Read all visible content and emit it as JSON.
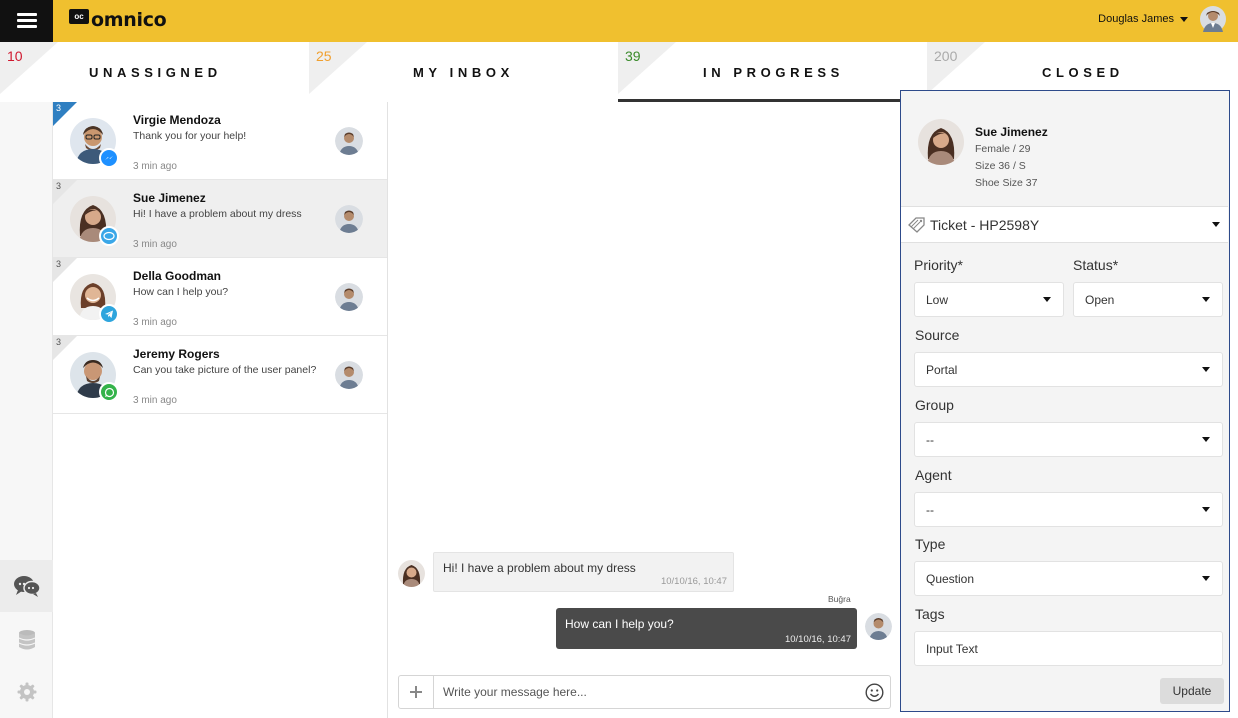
{
  "app": {
    "logo_badge": "oc",
    "logo_text": "omnico"
  },
  "header": {
    "user_name": "Douglas James"
  },
  "tabs": [
    {
      "count": "10",
      "count_color": "#d0182f",
      "label": "UNASSIGNED"
    },
    {
      "count": "25",
      "count_color": "#f0a030",
      "label": "MY INBOX"
    },
    {
      "count": "39",
      "count_color": "#3a8a2a",
      "label": "IN PROGRESS",
      "active": true
    },
    {
      "count": "200",
      "count_color": "#aaaaaa",
      "label": "CLOSED"
    }
  ],
  "sidebar": {
    "items": [
      {
        "icon": "chat-bubbles-icon",
        "active": true
      },
      {
        "icon": "database-icon"
      },
      {
        "icon": "gear-icon"
      }
    ]
  },
  "conversations": [
    {
      "badge": "3",
      "name": "Virgie Mendoza",
      "message": "Thank you for your help!",
      "time": "3 min ago",
      "channel": "messenger-icon",
      "channel_color": "#1e90ff",
      "unread": true
    },
    {
      "badge": "3",
      "name": "Sue Jimenez",
      "message": "Hi! I have a problem about my dress",
      "time": "3 min ago",
      "channel": "bip-icon",
      "channel_color": "#3aa7e8",
      "selected": true
    },
    {
      "badge": "3",
      "name": "Della Goodman",
      "message": "How can I help you?",
      "time": "3 min ago",
      "channel": "telegram-icon",
      "channel_color": "#2ea5dd"
    },
    {
      "badge": "3",
      "name": "Jeremy Rogers",
      "message": "Can you take picture of the user panel?",
      "time": "3 min ago",
      "channel": "whatsapp-icon",
      "channel_color": "#34b34a"
    }
  ],
  "chat": {
    "messages": [
      {
        "direction": "in",
        "text": "Hi! I have a problem about my dress",
        "time": "10/10/16, 10:47"
      },
      {
        "direction": "out",
        "sender": "Buğra",
        "text": "How can I help you?",
        "time": "10/10/16, 10:47"
      }
    ],
    "composer_placeholder": "Write your message here..."
  },
  "profile": {
    "name": "Sue Jimenez",
    "gender_age": "Female / 29",
    "size": "Size 36 / S",
    "shoe_size": "Shoe Size 37"
  },
  "ticket": {
    "title": "Ticket - HP2598Y",
    "fields": {
      "priority": {
        "label": "Priority*",
        "value": "Low"
      },
      "status": {
        "label": "Status*",
        "value": "Open"
      },
      "source": {
        "label": "Source",
        "value": "Portal"
      },
      "group": {
        "label": "Group",
        "value": "--"
      },
      "agent": {
        "label": "Agent",
        "value": "--"
      },
      "type": {
        "label": "Type",
        "value": "Question"
      },
      "tags": {
        "label": "Tags",
        "value": "Input Text"
      }
    },
    "update_label": "Update"
  }
}
